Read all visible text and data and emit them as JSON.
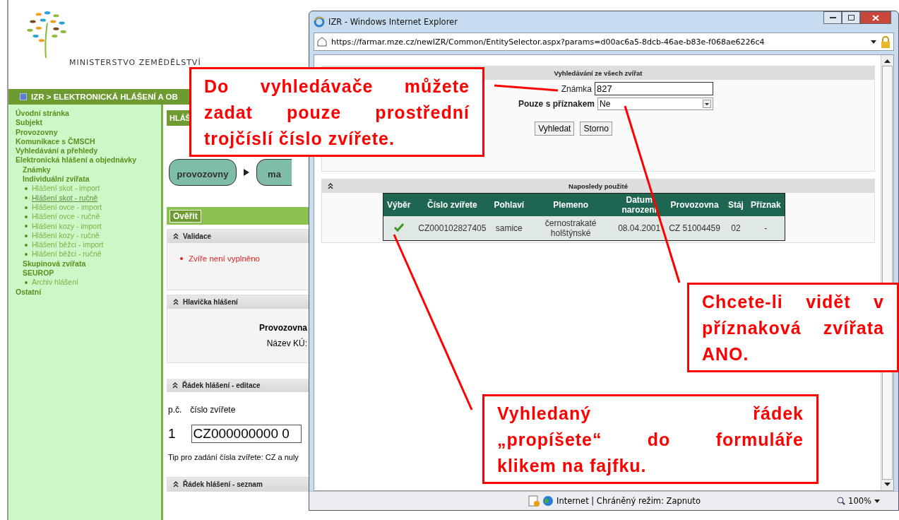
{
  "page": {
    "logo_text": "MINISTERSTVO ZEMĚDĚLSTVÍ",
    "breadcrumb": "IZR > ELEKTRONICKÁ HLÁŠENÍ A OB",
    "nav": [
      {
        "label": "Úvodní stránka",
        "selected": false
      },
      {
        "label": "Subjekt",
        "selected": false
      },
      {
        "label": "Provozovny",
        "selected": false
      },
      {
        "label": "Komunikace s ČMSCH",
        "selected": false
      },
      {
        "label": "Vyhledávání a přehledy",
        "selected": false
      },
      {
        "label": "Elektronická hlášení a objednávky",
        "selected": false,
        "children": [
          {
            "label": "Známky",
            "selected": false
          },
          {
            "label": "Individuální zvířata",
            "selected": false,
            "children": [
              {
                "label": "Hlášení skot - import",
                "selected": false
              },
              {
                "label": "Hlášení skot - ručně",
                "selected": true
              },
              {
                "label": "Hlášení ovce - import",
                "selected": false
              },
              {
                "label": "Hlášení ovce - ručně",
                "selected": false
              },
              {
                "label": "Hlášení kozy - import",
                "selected": false
              },
              {
                "label": "Hlášení kozy - ručně",
                "selected": false
              },
              {
                "label": "Hlášení běžci - import",
                "selected": false
              },
              {
                "label": "Hlášení běžci - ručně",
                "selected": false
              }
            ]
          },
          {
            "label": "Skupinová zvířata",
            "selected": false
          },
          {
            "label": "SEUROP",
            "selected": false,
            "children": [
              {
                "label": "Archiv hlášení",
                "selected": false
              }
            ]
          }
        ]
      },
      {
        "label": "Ostatní",
        "selected": false
      }
    ],
    "section_title": "HLÁŠ",
    "steps": [
      "provozovny",
      "ma"
    ],
    "verify_button": "Ověřit",
    "validation": {
      "title": "Validace",
      "errors": [
        "Zvíře není vyplněno"
      ]
    },
    "header_panel": {
      "title": "Hlavička hlášení",
      "labels": [
        "Provozovna",
        "Název KÚ:"
      ]
    },
    "edit_panel": {
      "title": "Řádek hlášení - editace",
      "col_number": "p.č.",
      "col_animal": "číslo zvířete",
      "row_number": "1",
      "animal_value": "CZ000000000 0",
      "tip": "Tip pro zadání čísla zvířete: CZ a nuly"
    },
    "list_panel": {
      "title": "Řádek hlášení - seznam"
    }
  },
  "popup": {
    "title": "IZR - Windows Internet Explorer",
    "url": "https://farmar.mze.cz/newIZR/Common/EntitySelector.aspx?params=d00ac6a5-8dcb-46ae-b83e-f068ae6226c4",
    "search": {
      "title": "Vyhledávání ze všech zvířat",
      "tag_label": "Známka",
      "tag_value": "827",
      "flag_label": "Pouze s příznakem",
      "flag_value": "Ne",
      "buttons": [
        "Vyhledat",
        "Storno"
      ]
    },
    "recent": {
      "title": "Naposledy použité",
      "columns": [
        "Výběr",
        "Číslo zvířete",
        "Pohlaví",
        "Plemeno",
        "Datum narození",
        "Provozovna",
        "Stáj",
        "Příznak"
      ],
      "rows": [
        {
          "cells": [
            "",
            "CZ000102827405",
            "samice",
            "černostrakaté holštýnské",
            "08.04.2001",
            "CZ 51004459",
            "02",
            "-"
          ]
        }
      ]
    },
    "status": "Internet | Chráněný režim: Zapnuto",
    "zoom": "100%"
  },
  "callouts": [
    {
      "lines": [
        "Do vyhledávače můžete",
        "zadat pouze prostřední",
        "trojčíslí číslo zvířete."
      ]
    },
    {
      "lines": [
        "Chcete-li vidět v",
        "příznaková zvířata",
        "ANO."
      ]
    },
    {
      "lines": [
        "Vyhledaný řádek",
        "„propíšete“ do formuláře",
        "klikem na fajfku."
      ]
    }
  ]
}
